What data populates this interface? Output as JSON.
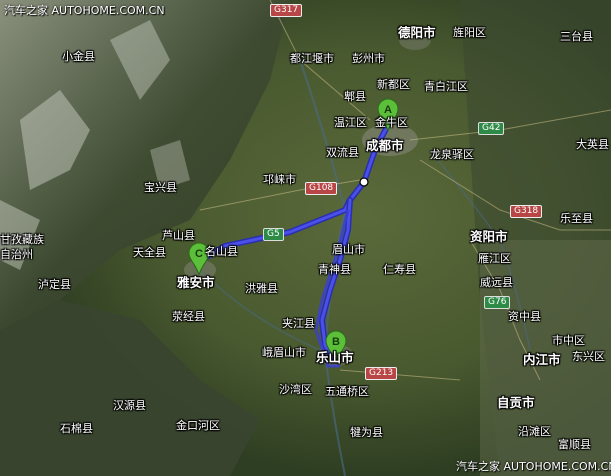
{
  "watermark_top": "汽车之家 AUTOHOME.COM.CN",
  "watermark_bottom": "汽车之家 AUTOHOME.COM.CN",
  "cities": {
    "deyang": "德阳市",
    "jingyang": "旌阳区",
    "sanxing": "三台县",
    "xiaojin": "小金县",
    "dujiangyan": "都江堰市",
    "pengzhou": "彭州市",
    "xindu": "新都区",
    "qingbaijiang": "青白江区",
    "pixian": "郫县",
    "wenjiang": "温江区",
    "jinniu": "金牛区",
    "chengdu": "成都市",
    "shuangliu": "双流县",
    "longquanyi": "龙泉驿区",
    "qionglai": "邛崃市",
    "baoxing": "宝兴县",
    "lushan": "芦山县",
    "mingshan": "名山县",
    "tianquan": "天全县",
    "yaan": "雅安市",
    "luding": "泸定县",
    "yingjing": "荥经县",
    "hongya": "洪雅县",
    "meishan": "眉山市",
    "qingshen": "青神县",
    "renshou": "仁寿县",
    "jianyang": "简阳市",
    "ziyang": "资阳市",
    "yanjiang": "雁江区",
    "lezhi": "乐至县",
    "dayingshort": "大英县",
    "ganzi_tibet": "甘孜藏族",
    "zizhizhou": "自治州",
    "jiajiang": "夹江县",
    "emeishan": "峨眉山市",
    "leshan": "乐山市",
    "shawan": "沙湾区",
    "wutongqiao": "五通桥区",
    "hanyuan": "汉源县",
    "jinkouhe": "金口河区",
    "shimian": "石棉县",
    "qianwei": "犍为县",
    "zizhong": "资中县",
    "shizhong": "市中区",
    "dongxing": "东兴区",
    "neijiang": "内江市",
    "zigong": "自贡市",
    "yanjiang2": "沿滩区",
    "fushun": "富顺县",
    "weiyuan": "威远县"
  },
  "roads": {
    "g317": "G317",
    "g42": "G42",
    "g108": "G108",
    "g318": "G318",
    "g76": "G76",
    "g213": "G213",
    "g5": "G5"
  },
  "markers": {
    "a": "A",
    "b": "B",
    "c": "C"
  },
  "colors": {
    "route": "#3a3fd8",
    "marker": "#5bbf3a"
  }
}
